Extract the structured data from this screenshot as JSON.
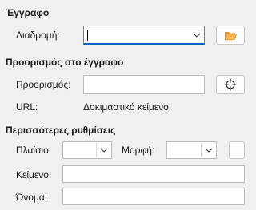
{
  "document_section": {
    "title": "Έγγραφο",
    "path_label": "Διαδρομή:",
    "path_value": ""
  },
  "target_section": {
    "title": "Προορισμός στο έγγραφο",
    "target_label": "Προορισμός:",
    "target_value": "",
    "url_label": "URL:",
    "url_value": "Δοκιμαστικό κείμενο"
  },
  "more_section": {
    "title": "Περισσότερες ρυθμίσεις",
    "frame_label": "Πλαίσιο:",
    "frame_value": "",
    "form_label": "Μορφή:",
    "form_value": "",
    "text_label": "Κείμενο:",
    "text_value": "",
    "name_label": "Όνομα:",
    "name_value": ""
  },
  "icons": {
    "open_file": "folder-open-icon",
    "target": "crosshair-icon",
    "dropdown": "chevron-down-icon"
  },
  "colors": {
    "focus": "#0067c0",
    "folder": "#f4a640",
    "background": "#f0f0f0"
  }
}
